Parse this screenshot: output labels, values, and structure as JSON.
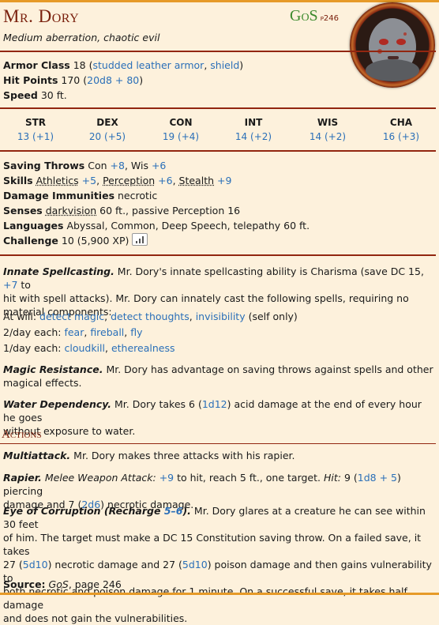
{
  "creature": {
    "name": "Mr. Dory",
    "source": "GoS",
    "page": "p246",
    "type_line": "Medium aberration, chaotic evil"
  },
  "armor_class": {
    "label": "Armor Class",
    "value": "18",
    "open": "(",
    "armor": "studded leather armor",
    "sep": ", ",
    "shield": "shield",
    "close": ")"
  },
  "hit_points": {
    "label": "Hit Points",
    "value": "170",
    "dice": "20d8 + 80"
  },
  "speed": {
    "label": "Speed",
    "value": "30 ft."
  },
  "abilities": [
    {
      "name": "STR",
      "score": "13 (+1)"
    },
    {
      "name": "DEX",
      "score": "20 (+5)"
    },
    {
      "name": "CON",
      "score": "19 (+4)"
    },
    {
      "name": "INT",
      "score": "14 (+2)"
    },
    {
      "name": "WIS",
      "score": "14 (+2)"
    },
    {
      "name": "CHA",
      "score": "16 (+3)"
    }
  ],
  "saving_throws": {
    "label": "Saving Throws",
    "con": "Con ",
    "con_val": "+8",
    "sep": ", Wis ",
    "wis_val": "+6"
  },
  "skills": {
    "label": "Skills",
    "athletics": "Athletics",
    "athletics_val": "+5",
    "perception": "Perception",
    "perception_val": "+6",
    "stealth": "Stealth",
    "stealth_val": "+9"
  },
  "damage_immunities": {
    "label": "Damage Immunities",
    "value": "necrotic"
  },
  "senses": {
    "label": "Senses",
    "darkvision": "darkvision",
    "rest": " 60 ft., passive Perception 16"
  },
  "languages": {
    "label": "Languages",
    "value": "Abyssal, Common, Deep Speech, telepathy 60 ft."
  },
  "challenge": {
    "label": "Challenge",
    "value": "10 (5,900 XP)"
  },
  "traits": {
    "spellcasting": {
      "title": "Innate Spellcasting.",
      "line1a": " Mr. Dory's innate spellcasting ability is Charisma (save DC 15, ",
      "bonus": "+7",
      "line1b": " to",
      "line2": "hit with spell attacks). Mr. Dory can innately cast the following spells, requiring no",
      "line3": "material components:",
      "at_will_label": "At will: ",
      "at_will": [
        "detect magic",
        "detect thoughts",
        "invisibility"
      ],
      "at_will_note": " (self only)",
      "two_day_label": "2/day each: ",
      "two_day": [
        "fear",
        "fireball",
        "fly"
      ],
      "one_day_label": "1/day each: ",
      "one_day": [
        "cloudkill",
        "etherealness"
      ]
    },
    "magic_resistance": {
      "title": "Magic Resistance.",
      "line1": " Mr. Dory has advantage on saving throws against spells and other",
      "line2": "magical effects."
    },
    "water_dependency": {
      "title": "Water Dependency.",
      "line1a": " Mr. Dory takes 6 (",
      "dice": "1d12",
      "line1b": ") acid damage at the end of every hour he goes",
      "line2": "without exposure to water."
    }
  },
  "actions": {
    "title": "Actions",
    "multiattack": {
      "title": "Multiattack.",
      "text": " Mr. Dory makes three attacks with his rapier."
    },
    "rapier": {
      "title": "Rapier.",
      "kind": " Melee Weapon Attack: ",
      "bonus": "+9",
      "mid": " to hit, reach 5 ft., one target. ",
      "hit": "Hit:",
      "dmg1a": " 9 (",
      "dice1": "1d8 + 5",
      "dmg1b": ") piercing",
      "line2a": "damage and 7 (",
      "dice2": "2d6",
      "line2b": ") necrotic damage."
    },
    "eye": {
      "title": "Eye of Corruption (Recharge ",
      "recharge": "5–6",
      "title_end": ").",
      "line1": " Mr. Dory glares at a creature he can see within 30 feet",
      "line2": "of him. The target must make a DC 15 Constitution saving throw. On a failed save, it takes",
      "line3a": "27 (",
      "dice1": "5d10",
      "line3b": ") necrotic damage and 27 (",
      "dice2": "5d10",
      "line3c": ") poison damage and then gains vulnerability to",
      "line4": "both necrotic and poison damage for 1 minute. On a successful save, it takes half damage",
      "line5": "and does not gain the vulnerabilities."
    }
  },
  "footer": {
    "label": "Source:",
    "book": "GoS",
    "page": ", page 246"
  },
  "colors": {
    "title": "#7a200d",
    "source": "#3c8a2c",
    "link": "#2a6fb8",
    "rule": "#922610",
    "bar": "#e69a28",
    "background": "#fdf1dc"
  }
}
